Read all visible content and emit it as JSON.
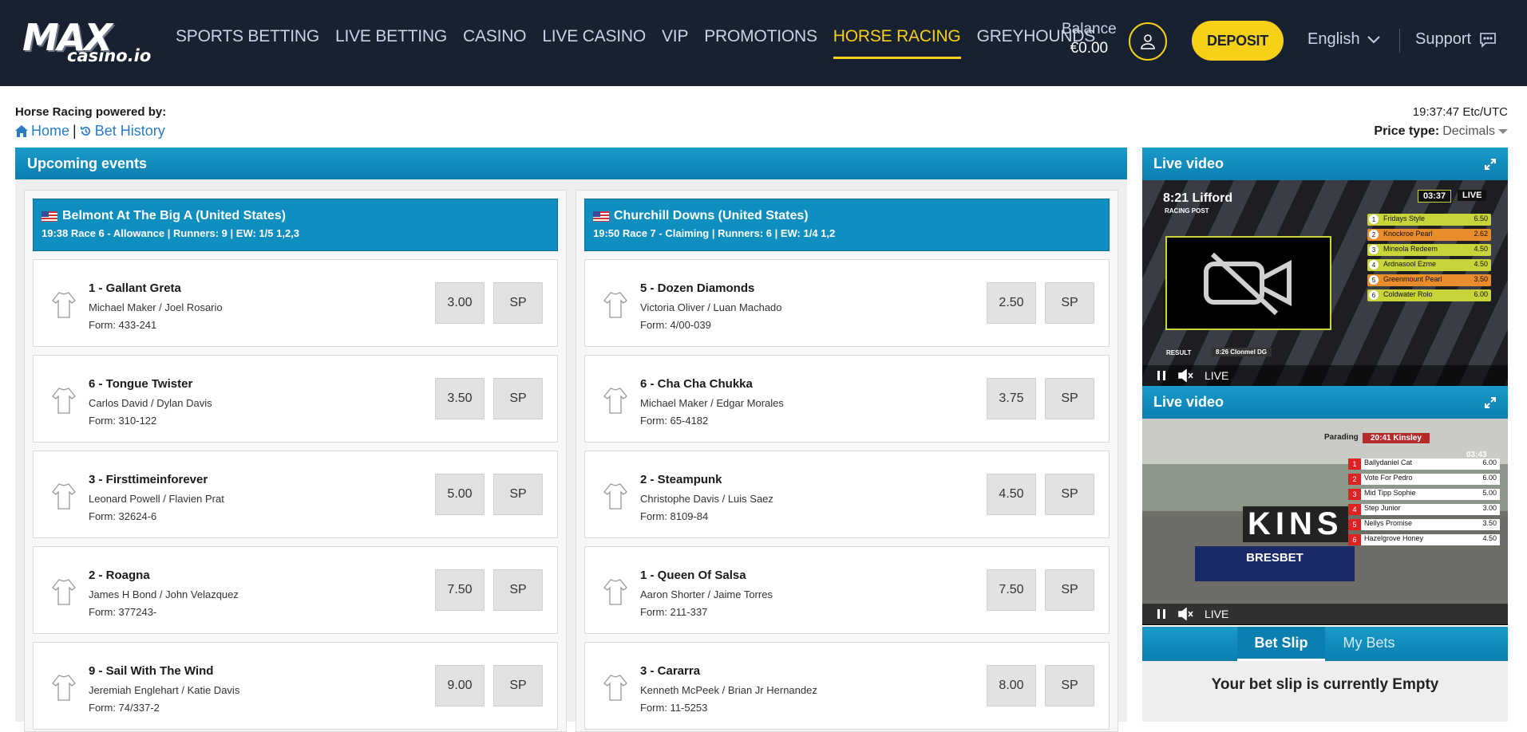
{
  "header": {
    "logo_main": "MAX",
    "logo_sub": "casino.io",
    "nav": [
      {
        "label": "SPORTS BETTING"
      },
      {
        "label": "LIVE BETTING"
      },
      {
        "label": "CASINO"
      },
      {
        "label": "LIVE CASINO"
      },
      {
        "label": "VIP"
      },
      {
        "label": "PROMOTIONS"
      },
      {
        "label": "HORSE RACING",
        "active": true
      },
      {
        "label": "GREYHOUNDS"
      }
    ],
    "balance_label": "Balance",
    "balance_value": "€0.00",
    "deposit_label": "DEPOSIT",
    "language": "English",
    "support": "Support",
    "accent_color": "#f7d117"
  },
  "subheader": {
    "powered_by": "Horse Racing powered by:",
    "home": "Home",
    "separator": "|",
    "bet_history": "Bet History",
    "time": "19:37:47 Etc/UTC",
    "price_type_label": "Price type:",
    "price_type_value": "Decimals"
  },
  "upcoming": {
    "title": "Upcoming events",
    "meetings": [
      {
        "title": "Belmont At The Big A (United States)",
        "info": "19:38 Race 6 - Allowance | Runners: 9 | EW: 1/5 1,2,3",
        "runners": [
          {
            "name": "1 - Gallant Greta",
            "people": "Michael Maker / Joel Rosario",
            "form": "Form: 433-241",
            "odds": "3.00",
            "sp": "SP"
          },
          {
            "name": "6 - Tongue Twister",
            "people": "Carlos David / Dylan Davis",
            "form": "Form: 310-122",
            "odds": "3.50",
            "sp": "SP"
          },
          {
            "name": "3 - Firsttimeinforever",
            "people": "Leonard Powell / Flavien Prat",
            "form": "Form: 32624-6",
            "odds": "5.00",
            "sp": "SP"
          },
          {
            "name": "2 - Roagna",
            "people": "James H Bond / John Velazquez",
            "form": "Form: 377243-",
            "odds": "7.50",
            "sp": "SP"
          },
          {
            "name": "9 - Sail With The Wind",
            "people": "Jeremiah Englehart / Katie Davis",
            "form": "Form: 74/337-2",
            "odds": "9.00",
            "sp": "SP"
          }
        ]
      },
      {
        "title": "Churchill Downs (United States)",
        "info": "19:50 Race 7 - Claiming | Runners: 6 | EW: 1/4 1,2",
        "runners": [
          {
            "name": "5 - Dozen Diamonds",
            "people": "Victoria Oliver / Luan Machado",
            "form": "Form: 4/00-039",
            "odds": "2.50",
            "sp": "SP"
          },
          {
            "name": "6 - Cha Cha Chukka",
            "people": "Michael Maker / Edgar Morales",
            "form": "Form: 65-4182",
            "odds": "3.75",
            "sp": "SP"
          },
          {
            "name": "2 - Steampunk",
            "people": "Christophe Davis / Luis Saez",
            "form": "Form: 8109-84",
            "odds": "4.50",
            "sp": "SP"
          },
          {
            "name": "1 - Queen Of Salsa",
            "people": "Aaron Shorter / Jaime Torres",
            "form": "Form: 211-337",
            "odds": "7.50",
            "sp": "SP"
          },
          {
            "name": "3 - Cararra",
            "people": "Kenneth McPeek / Brian Jr Hernandez",
            "form": "Form: 11-5253",
            "odds": "8.00",
            "sp": "SP"
          }
        ]
      }
    ]
  },
  "videos": [
    {
      "title": "Live video",
      "overlay_race": "8:21 Lifford",
      "overlay_brand": "RACING POST",
      "overlay_timer": "03:37",
      "overlay_live": "LIVE",
      "result_label": "RESULT",
      "result_value": "8:26 Clonmel DG",
      "live": "LIVE",
      "card": [
        {
          "n": "1",
          "name": "Fridays Style",
          "price": "6.50"
        },
        {
          "n": "2",
          "name": "Knockroe Pearl",
          "price": "2.62"
        },
        {
          "n": "3",
          "name": "Mineola Redeem",
          "price": "4.50"
        },
        {
          "n": "4",
          "name": "Ardnasool Ezme",
          "price": "4.50"
        },
        {
          "n": "5",
          "name": "Greenmount Pearl",
          "price": "3.50"
        },
        {
          "n": "6",
          "name": "Coldwater Rolo",
          "price": "6.00"
        }
      ]
    },
    {
      "title": "Live video",
      "overlay_race": "20:41 Kinsley",
      "overlay_status": "Parading",
      "overlay_timer": "03:43",
      "board_text": "KINS",
      "sponsor": "BRESBET",
      "live": "LIVE",
      "card": [
        {
          "n": "1",
          "name": "Ballydaniel Cat",
          "price": "6.00"
        },
        {
          "n": "2",
          "name": "Vote For Pedro",
          "price": "6.00"
        },
        {
          "n": "3",
          "name": "Mid Tipp Sophie",
          "price": "5.00"
        },
        {
          "n": "4",
          "name": "Step Junior",
          "price": "3.00"
        },
        {
          "n": "5",
          "name": "Nellys Promise",
          "price": "3.50"
        },
        {
          "n": "6",
          "name": "Hazelgrove Honey",
          "price": "4.50"
        }
      ]
    }
  ],
  "betslip": {
    "tab_betslip": "Bet Slip",
    "tab_mybets": "My Bets",
    "empty": "Your bet slip is currently Empty"
  }
}
